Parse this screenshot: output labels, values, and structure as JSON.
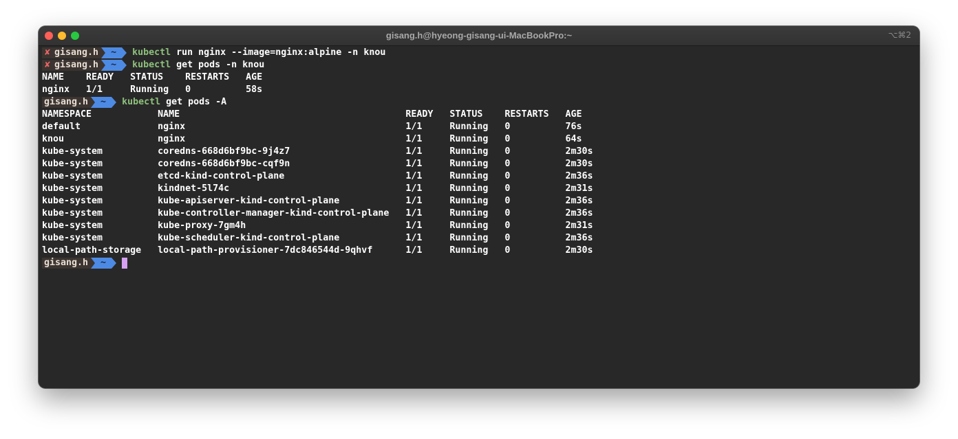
{
  "window": {
    "title": "gisang.h@hyeong-gisang-ui-MacBookPro:~",
    "shortcut": "⌥⌘2"
  },
  "prompt": {
    "user": "gisang.h",
    "dir": "~",
    "error_mark": "✘"
  },
  "commands": [
    {
      "cmd": "kubectl",
      "args": " run nginx --image=nginx:alpine -n knou"
    },
    {
      "cmd": "kubectl",
      "args": " get pods -n knou"
    },
    {
      "cmd": "kubectl",
      "args": " get pods -A"
    }
  ],
  "pods_knou": {
    "headers": [
      "NAME",
      "READY",
      "STATUS",
      "RESTARTS",
      "AGE"
    ],
    "rows": [
      [
        "nginx",
        "1/1",
        "Running",
        "0",
        "58s"
      ]
    ]
  },
  "pods_all": {
    "headers": [
      "NAMESPACE",
      "NAME",
      "READY",
      "STATUS",
      "RESTARTS",
      "AGE"
    ],
    "rows": [
      [
        "default",
        "nginx",
        "1/1",
        "Running",
        "0",
        "76s"
      ],
      [
        "knou",
        "nginx",
        "1/1",
        "Running",
        "0",
        "64s"
      ],
      [
        "kube-system",
        "coredns-668d6bf9bc-9j4z7",
        "1/1",
        "Running",
        "0",
        "2m30s"
      ],
      [
        "kube-system",
        "coredns-668d6bf9bc-cqf9n",
        "1/1",
        "Running",
        "0",
        "2m30s"
      ],
      [
        "kube-system",
        "etcd-kind-control-plane",
        "1/1",
        "Running",
        "0",
        "2m36s"
      ],
      [
        "kube-system",
        "kindnet-5l74c",
        "1/1",
        "Running",
        "0",
        "2m31s"
      ],
      [
        "kube-system",
        "kube-apiserver-kind-control-plane",
        "1/1",
        "Running",
        "0",
        "2m36s"
      ],
      [
        "kube-system",
        "kube-controller-manager-kind-control-plane",
        "1/1",
        "Running",
        "0",
        "2m36s"
      ],
      [
        "kube-system",
        "kube-proxy-7gm4h",
        "1/1",
        "Running",
        "0",
        "2m31s"
      ],
      [
        "kube-system",
        "kube-scheduler-kind-control-plane",
        "1/1",
        "Running",
        "0",
        "2m36s"
      ],
      [
        "local-path-storage",
        "local-path-provisioner-7dc846544d-9qhvf",
        "1/1",
        "Running",
        "0",
        "2m30s"
      ]
    ]
  },
  "colors": {
    "terminal_bg": "#282828",
    "command": "#8ec07c",
    "prompt_user_bg": "#3b3430",
    "prompt_dir_bg": "#4d8ae4",
    "error": "#e86565",
    "cursor": "#d6a1f2"
  }
}
